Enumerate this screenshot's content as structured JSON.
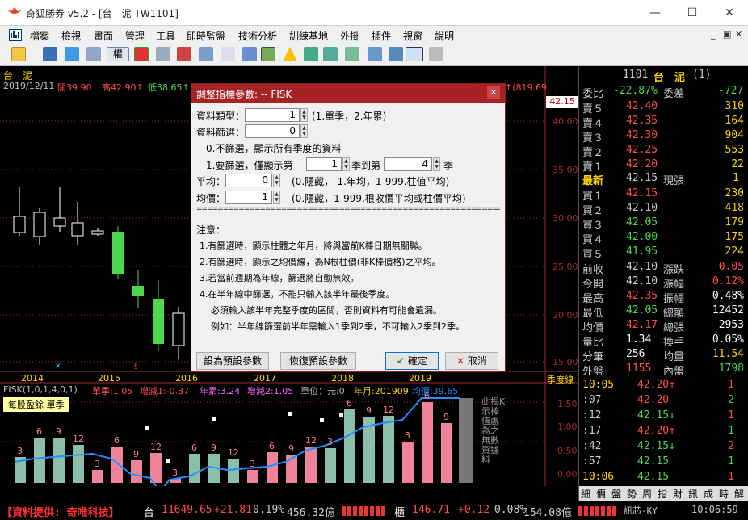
{
  "window": {
    "title": "奇狐勝券 v5.2 - [台　泥 TW1101]",
    "minimize": "—",
    "maximize": "☐",
    "close": "✕"
  },
  "menu": {
    "items": [
      "檔案",
      "檢視",
      "畫面",
      "管理",
      "工具",
      "即時監盤",
      "技術分析",
      "訓練基地",
      "外掛",
      "插件",
      "視窗",
      "說明"
    ],
    "mdi_min": "_",
    "mdi_restore": "▣",
    "mdi_close": "✕"
  },
  "toolbar": {
    "quan_label": "權"
  },
  "chart": {
    "stock_name": "台　泥",
    "date": "2019/12/11",
    "ohlc": {
      "open": "開39.90",
      "high": "高42.90↑",
      "low": "低38.65↑"
    },
    "ohlc_tail": "漲停 8.60↑(819.69",
    "price_tag": "42.15",
    "price_axis": [
      "40.00",
      "35.00",
      "30.00",
      "25.00",
      "20.00",
      "15.00"
    ],
    "years": [
      "2014",
      "2015",
      "2016",
      "2017",
      "2018",
      "2019"
    ],
    "season_label": "季度線",
    "indicator_header": {
      "name": "FISK(1,0,1,4,0,1)",
      "single": "單季:1.05",
      "yoy": "增減1:-0.37",
      "annual": "年累:3.24",
      "yoy2": "增減2:1.05",
      "unit": "單位：元:0",
      "ym": "年月:201909",
      "avg": "均價:39.65"
    },
    "eps_badge": "每股盈餘 單季",
    "eps_axis": [
      "1.50",
      "1.00",
      "0.50",
      "0.00"
    ],
    "vertical_note": "此揭K示棒值處為之無數資據料",
    "bar_labels": [
      "3",
      "6",
      "9",
      "12",
      "3",
      "6",
      "9",
      "12",
      "3",
      "6",
      "9",
      "12",
      "3",
      "6",
      "9",
      "12",
      "3",
      "6",
      "9",
      "12",
      "3",
      "6",
      "9"
    ]
  },
  "dialog": {
    "title": "調整指標參數: -- FISK",
    "close": "✕",
    "field_type_label": "資料類型：",
    "field_type_value": "1",
    "field_type_hint": "(1.單季，2.年累)",
    "field_filter_label": "資料篩選：",
    "field_filter_value": "0",
    "filter_opt0": "0.不篩選，顯示所有季度的資料",
    "filter_opt1": "1.要篩選，僅顯示第",
    "season_from": "1",
    "season_to_label": "季到第",
    "season_to": "4",
    "season_suffix": "季",
    "avg_label": "平均：",
    "avg_value": "0",
    "avg_hint": "(0.隱藏，-1.年均，1-999.柱值平均)",
    "mean_label": "均價：",
    "mean_value": "1",
    "mean_hint": "(0.隱藏，1-999.根收價平均或柱價平均)",
    "separator": "=============================================================",
    "notes_title": "注意：",
    "notes": [
      "1.有篩選時，顯示柱體之年月，將與當前K棒日期無關聯。",
      "2.有篩選時，顯示之均價線，為N根柱價(非K棒價格)之平均。",
      "3.若當前週期為年線，篩選將自動無效。",
      "4.在半年線中篩選，不能只輸入該半年最後季度。",
      "必須輸入該半年完整季度的區間，否則資料有可能會遺漏。",
      "例如：半年線篩選前半年需輸入1季到2季，不可輸入2季到2季。"
    ],
    "btn_default": "設為預設參數",
    "btn_restore": "恢復預設參數",
    "btn_ok": "確定",
    "btn_cancel": "取消"
  },
  "quote": {
    "code": "1101",
    "name": "台　泥",
    "count": "(1)",
    "weibi_label": "委比",
    "weibi_value": "-22.87%",
    "weicha_label": "委差",
    "weicha_value": "-727",
    "asks": [
      {
        "label": "賣５",
        "price": "42.40",
        "vol": "310"
      },
      {
        "label": "賣４",
        "price": "42.35",
        "vol": "164"
      },
      {
        "label": "賣３",
        "price": "42.30",
        "vol": "904"
      },
      {
        "label": "賣２",
        "price": "42.25",
        "vol": "553"
      },
      {
        "label": "賣１",
        "price": "42.20",
        "vol": "22"
      }
    ],
    "last_label": "最新",
    "last_price": "42.15",
    "now_label": "現張",
    "now_vol": "1",
    "bids": [
      {
        "label": "買１",
        "price": "42.15",
        "vol": "230"
      },
      {
        "label": "買２",
        "price": "42.10",
        "vol": "418"
      },
      {
        "label": "買３",
        "price": "42.05",
        "vol": "179"
      },
      {
        "label": "買４",
        "price": "42.00",
        "vol": "175"
      },
      {
        "label": "買５",
        "price": "41.95",
        "vol": "224"
      }
    ],
    "stats": [
      {
        "l1": "前收",
        "v1": "42.10",
        "l2": "漲跌",
        "v2": "0.05"
      },
      {
        "l1": "今開",
        "v1": "42.10",
        "l2": "漲幅",
        "v2": "0.12%"
      },
      {
        "l1": "最高",
        "v1": "42.35",
        "l2": "振幅",
        "v2": "0.48%"
      },
      {
        "l1": "最低",
        "v1": "42.05",
        "l2": "總額",
        "v2": "12452"
      },
      {
        "l1": "均價",
        "v1": "42.17",
        "l2": "總張",
        "v2": "2953"
      },
      {
        "l1": "量比",
        "v1": "1.34",
        "l2": "換手",
        "v2": "0.05%"
      },
      {
        "l1": "分筆",
        "v1": "256",
        "l2": "均量",
        "v2": "11.54"
      },
      {
        "l1": "外盤",
        "v1": "1155",
        "l2": "內盤",
        "v2": "1798"
      }
    ],
    "ticks": [
      {
        "time": "10:05",
        "price": "42.20↑",
        "vol": "1"
      },
      {
        "time": ":07",
        "price": "42.20",
        "vol": "2"
      },
      {
        "time": ":12",
        "price": "42.15↓",
        "vol": "1"
      },
      {
        "time": ":17",
        "price": "42.20↑",
        "vol": "1"
      },
      {
        "time": ":42",
        "price": "42.15↓",
        "vol": "2"
      },
      {
        "time": ":57",
        "price": "42.15",
        "vol": "1"
      },
      {
        "time": "10:06",
        "price": "42.15",
        "vol": "1"
      }
    ],
    "tabs": [
      "細",
      "價",
      "盤",
      "勢",
      "周",
      "指",
      "財",
      "訊",
      "成",
      "時",
      "解"
    ]
  },
  "statusbar": {
    "provider": "【資料提供: 奇唯科技】",
    "idx1_name": "台",
    "idx1_value": "11649.65",
    "idx1_change": "+21.81",
    "idx1_pct": "0.19%",
    "idx1_amount": "456.32億",
    "idx2_name": "櫃",
    "idx2_value": "146.71",
    "idx2_change": "+0.12",
    "idx2_pct": "0.08%",
    "idx2_amount": "154.08億",
    "signal": "訊芯-KY",
    "time": "10:06:59"
  }
}
